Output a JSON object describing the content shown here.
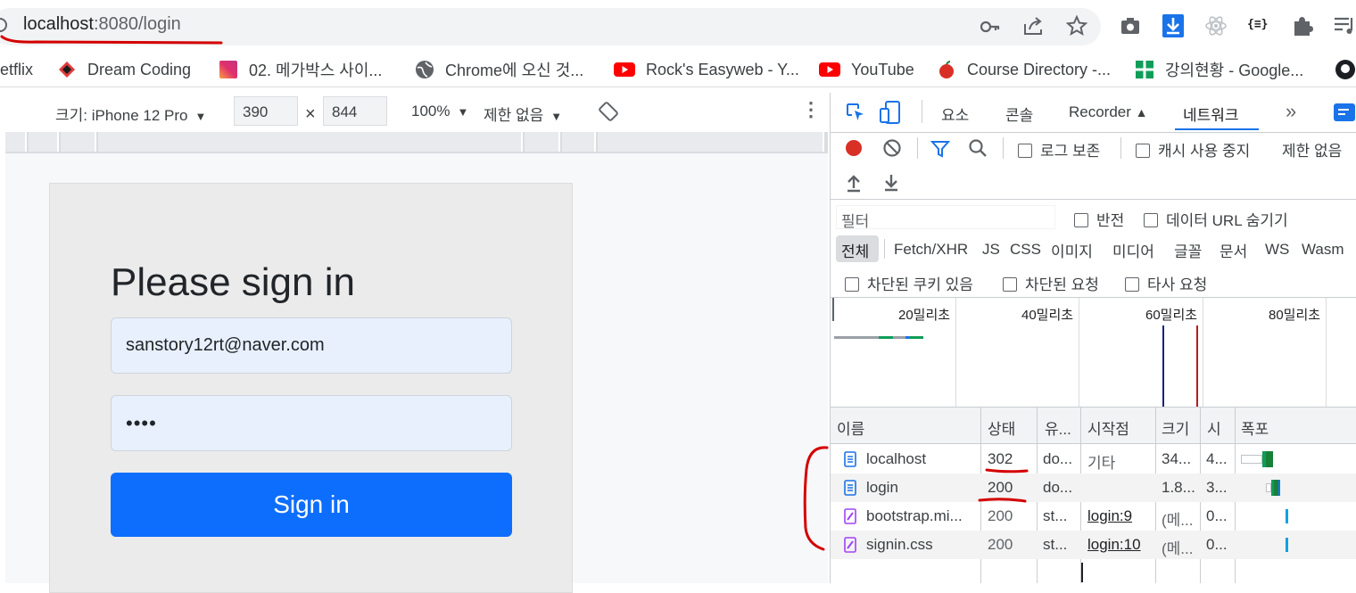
{
  "browser": {
    "url_host": "localhost",
    "url_path": ":8080/login",
    "bookmarks": [
      {
        "label": "etflix",
        "icon": "netflix-icon"
      },
      {
        "label": "Dream Coding",
        "icon": "dream-coding-icon"
      },
      {
        "label": "02. 메가박스 사이...",
        "icon": "instagram-icon"
      },
      {
        "label": "Chrome에 오신 것...",
        "icon": "globe-icon"
      },
      {
        "label": "Rock's Easyweb - Y...",
        "icon": "youtube-icon"
      },
      {
        "label": "YouTube",
        "icon": "youtube-icon"
      },
      {
        "label": "Course Directory -...",
        "icon": "apple-icon"
      },
      {
        "label": "강의현황 - Google...",
        "icon": "google-sheets-icon"
      }
    ],
    "accent": "#1a73e8"
  },
  "device_toolbar": {
    "size_label": "크기: iPhone 12 Pro",
    "width": "390",
    "times": "×",
    "height": "844",
    "zoom": "100%",
    "throttle": "제한 없음"
  },
  "page": {
    "title": "Please sign in",
    "email_value": "sanstory12rt@naver.com",
    "password_value": "••••",
    "signin_button": "Sign in",
    "button_color": "#0d6efd"
  },
  "devtools": {
    "tabs": [
      "요소",
      "콘솔",
      "Recorder",
      "네트워크"
    ],
    "active_tab": "네트워크",
    "preserve_log": "로그 보존",
    "disable_cache": "캐시 사용 중지",
    "throttling": "제한 없음",
    "filter_placeholder": "필터",
    "invert": "반전",
    "hide_data_urls": "데이터 URL 숨기기",
    "type_filters": [
      "전체",
      "Fetch/XHR",
      "JS",
      "CSS",
      "이미지",
      "미디어",
      "글꼴",
      "문서",
      "WS",
      "Wasm"
    ],
    "blocked_cookies": "차단된 쿠키 있음",
    "blocked_requests": "차단된 요청",
    "third_party": "타사 요청",
    "timeline_labels": [
      "20밀리초",
      "40밀리초",
      "60밀리초",
      "80밀리초"
    ],
    "columns": [
      "이름",
      "상태",
      "유...",
      "시작점",
      "크기",
      "시",
      "폭포"
    ],
    "rows": [
      {
        "name": "localhost",
        "status": "302",
        "type": "do...",
        "initiator": "기타",
        "size": "34...",
        "time": "4...",
        "kind": "doc"
      },
      {
        "name": "login",
        "status": "200",
        "type": "do...",
        "initiator": "",
        "size": "1.8...",
        "time": "3...",
        "kind": "doc"
      },
      {
        "name": "bootstrap.mi...",
        "status": "200",
        "type": "st...",
        "initiator": "login:9",
        "size": "(메...",
        "time": "0...",
        "kind": "css"
      },
      {
        "name": "signin.css",
        "status": "200",
        "type": "st...",
        "initiator": "login:10",
        "size": "(메...",
        "time": "0...",
        "kind": "css"
      }
    ]
  }
}
